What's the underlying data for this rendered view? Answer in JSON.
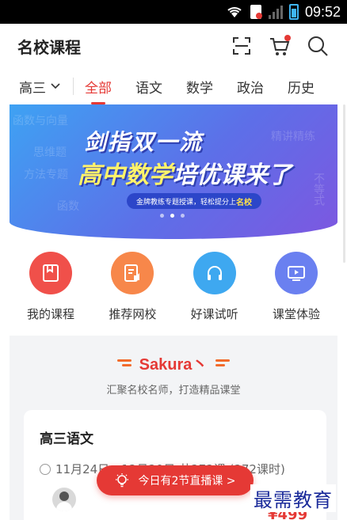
{
  "status_bar": {
    "time": "09:52"
  },
  "header": {
    "title": "名校课程"
  },
  "tabs": {
    "grade": "高三",
    "items": [
      {
        "label": "全部",
        "active": true
      },
      {
        "label": "语文"
      },
      {
        "label": "数学"
      },
      {
        "label": "政治"
      },
      {
        "label": "历史"
      }
    ]
  },
  "banner": {
    "headline_1": "剑指双一流",
    "headline_2_a": "高中数学",
    "headline_2_b": "培优课来了",
    "pill_text": "金牌教练专题授课，轻松提分上",
    "pill_highlight": "名校",
    "bg_words": [
      "函数与向量",
      "思维题",
      "方法专题",
      "函数",
      "不等式",
      "精讲精练"
    ],
    "pages": 3,
    "current_page": 2
  },
  "quick_entries": [
    {
      "label": "我的课程",
      "icon": "book-icon",
      "color": "#f0504a"
    },
    {
      "label": "推荐网校",
      "icon": "recommend-icon",
      "color": "#f7874a"
    },
    {
      "label": "好课试听",
      "icon": "headphone-icon",
      "color": "#3ea8f0"
    },
    {
      "label": "课堂体验",
      "icon": "video-icon",
      "color": "#6a80f0"
    }
  ],
  "section": {
    "brand": "Sakura丶",
    "subtitle": "汇聚名校名师，打造精品课堂",
    "card": {
      "title": "高三语文",
      "date_text": "11月24日 - 12月20日 共272课 (272课时)",
      "price": "¥499"
    }
  },
  "live_button": {
    "label": "今日有2节直播课 >"
  },
  "watermark": "最需教育",
  "colors": {
    "accent": "#e53935"
  }
}
